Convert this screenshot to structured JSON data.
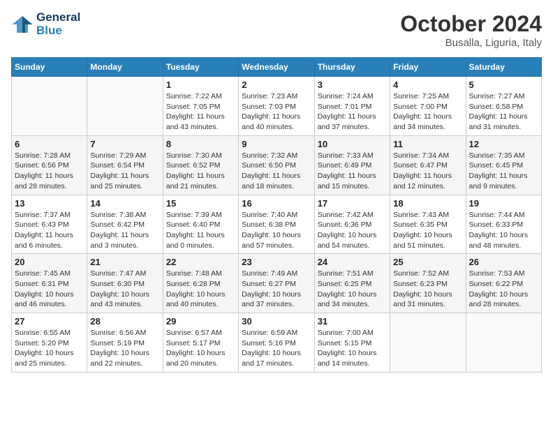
{
  "header": {
    "logo_line1": "General",
    "logo_line2": "Blue",
    "month": "October 2024",
    "location": "Busalla, Liguria, Italy"
  },
  "weekdays": [
    "Sunday",
    "Monday",
    "Tuesday",
    "Wednesday",
    "Thursday",
    "Friday",
    "Saturday"
  ],
  "weeks": [
    [
      {
        "day": "",
        "info": ""
      },
      {
        "day": "",
        "info": ""
      },
      {
        "day": "1",
        "info": "Sunrise: 7:22 AM\nSunset: 7:05 PM\nDaylight: 11 hours and 43 minutes."
      },
      {
        "day": "2",
        "info": "Sunrise: 7:23 AM\nSunset: 7:03 PM\nDaylight: 11 hours and 40 minutes."
      },
      {
        "day": "3",
        "info": "Sunrise: 7:24 AM\nSunset: 7:01 PM\nDaylight: 11 hours and 37 minutes."
      },
      {
        "day": "4",
        "info": "Sunrise: 7:25 AM\nSunset: 7:00 PM\nDaylight: 11 hours and 34 minutes."
      },
      {
        "day": "5",
        "info": "Sunrise: 7:27 AM\nSunset: 6:58 PM\nDaylight: 11 hours and 31 minutes."
      }
    ],
    [
      {
        "day": "6",
        "info": "Sunrise: 7:28 AM\nSunset: 6:56 PM\nDaylight: 11 hours and 28 minutes."
      },
      {
        "day": "7",
        "info": "Sunrise: 7:29 AM\nSunset: 6:54 PM\nDaylight: 11 hours and 25 minutes."
      },
      {
        "day": "8",
        "info": "Sunrise: 7:30 AM\nSunset: 6:52 PM\nDaylight: 11 hours and 21 minutes."
      },
      {
        "day": "9",
        "info": "Sunrise: 7:32 AM\nSunset: 6:50 PM\nDaylight: 11 hours and 18 minutes."
      },
      {
        "day": "10",
        "info": "Sunrise: 7:33 AM\nSunset: 6:49 PM\nDaylight: 11 hours and 15 minutes."
      },
      {
        "day": "11",
        "info": "Sunrise: 7:34 AM\nSunset: 6:47 PM\nDaylight: 11 hours and 12 minutes."
      },
      {
        "day": "12",
        "info": "Sunrise: 7:35 AM\nSunset: 6:45 PM\nDaylight: 11 hours and 9 minutes."
      }
    ],
    [
      {
        "day": "13",
        "info": "Sunrise: 7:37 AM\nSunset: 6:43 PM\nDaylight: 11 hours and 6 minutes."
      },
      {
        "day": "14",
        "info": "Sunrise: 7:38 AM\nSunset: 6:42 PM\nDaylight: 11 hours and 3 minutes."
      },
      {
        "day": "15",
        "info": "Sunrise: 7:39 AM\nSunset: 6:40 PM\nDaylight: 11 hours and 0 minutes."
      },
      {
        "day": "16",
        "info": "Sunrise: 7:40 AM\nSunset: 6:38 PM\nDaylight: 10 hours and 57 minutes."
      },
      {
        "day": "17",
        "info": "Sunrise: 7:42 AM\nSunset: 6:36 PM\nDaylight: 10 hours and 54 minutes."
      },
      {
        "day": "18",
        "info": "Sunrise: 7:43 AM\nSunset: 6:35 PM\nDaylight: 10 hours and 51 minutes."
      },
      {
        "day": "19",
        "info": "Sunrise: 7:44 AM\nSunset: 6:33 PM\nDaylight: 10 hours and 48 minutes."
      }
    ],
    [
      {
        "day": "20",
        "info": "Sunrise: 7:45 AM\nSunset: 6:31 PM\nDaylight: 10 hours and 46 minutes."
      },
      {
        "day": "21",
        "info": "Sunrise: 7:47 AM\nSunset: 6:30 PM\nDaylight: 10 hours and 43 minutes."
      },
      {
        "day": "22",
        "info": "Sunrise: 7:48 AM\nSunset: 6:28 PM\nDaylight: 10 hours and 40 minutes."
      },
      {
        "day": "23",
        "info": "Sunrise: 7:49 AM\nSunset: 6:27 PM\nDaylight: 10 hours and 37 minutes."
      },
      {
        "day": "24",
        "info": "Sunrise: 7:51 AM\nSunset: 6:25 PM\nDaylight: 10 hours and 34 minutes."
      },
      {
        "day": "25",
        "info": "Sunrise: 7:52 AM\nSunset: 6:23 PM\nDaylight: 10 hours and 31 minutes."
      },
      {
        "day": "26",
        "info": "Sunrise: 7:53 AM\nSunset: 6:22 PM\nDaylight: 10 hours and 28 minutes."
      }
    ],
    [
      {
        "day": "27",
        "info": "Sunrise: 6:55 AM\nSunset: 5:20 PM\nDaylight: 10 hours and 25 minutes."
      },
      {
        "day": "28",
        "info": "Sunrise: 6:56 AM\nSunset: 5:19 PM\nDaylight: 10 hours and 22 minutes."
      },
      {
        "day": "29",
        "info": "Sunrise: 6:57 AM\nSunset: 5:17 PM\nDaylight: 10 hours and 20 minutes."
      },
      {
        "day": "30",
        "info": "Sunrise: 6:59 AM\nSunset: 5:16 PM\nDaylight: 10 hours and 17 minutes."
      },
      {
        "day": "31",
        "info": "Sunrise: 7:00 AM\nSunset: 5:15 PM\nDaylight: 10 hours and 14 minutes."
      },
      {
        "day": "",
        "info": ""
      },
      {
        "day": "",
        "info": ""
      }
    ]
  ]
}
